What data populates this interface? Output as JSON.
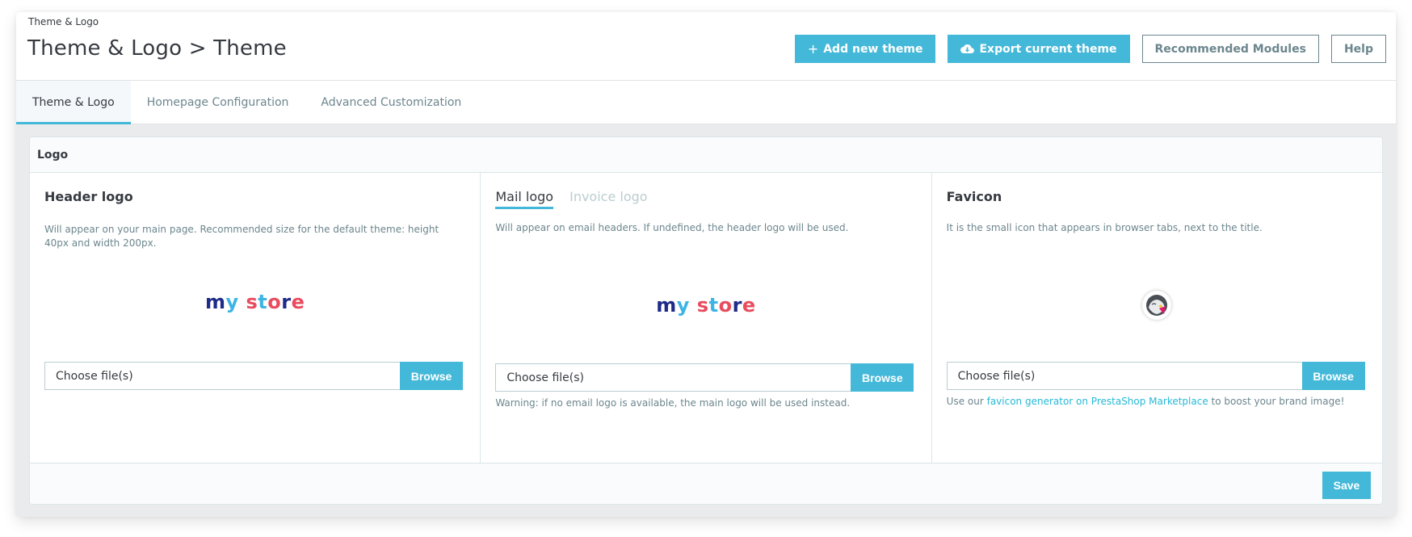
{
  "header": {
    "breadcrumb": "Theme & Logo",
    "title": "Theme & Logo > Theme",
    "toolbar": {
      "add_theme": "Add new theme",
      "export_theme": "Export current theme",
      "recommended_modules": "Recommended Modules",
      "help": "Help"
    }
  },
  "tabs": [
    {
      "label": "Theme & Logo",
      "active": true
    },
    {
      "label": "Homepage Configuration",
      "active": false
    },
    {
      "label": "Advanced Customization",
      "active": false
    }
  ],
  "card": {
    "title": "Logo",
    "header_logo": {
      "title": "Header logo",
      "description": "Will appear on your main page. Recommended size for the default theme: height 40px and width 200px.",
      "preview_text": "my store",
      "file_placeholder": "Choose file(s)",
      "browse": "Browse"
    },
    "mail_logo": {
      "subtabs": [
        "Mail logo",
        "Invoice logo"
      ],
      "active_subtab": "Mail logo",
      "description": "Will appear on email headers. If undefined, the header logo will be used.",
      "preview_text": "my store",
      "file_placeholder": "Choose file(s)",
      "browse": "Browse",
      "warning": "Warning: if no email logo is available, the main logo will be used instead."
    },
    "favicon": {
      "title": "Favicon",
      "description": "It is the small icon that appears in browser tabs, next to the title.",
      "file_placeholder": "Choose file(s)",
      "browse": "Browse",
      "help_prefix": "Use our ",
      "help_link": "favicon generator on PrestaShop Marketplace",
      "help_suffix": " to boost your brand image!"
    },
    "save": "Save"
  },
  "colors": {
    "primary": "#44b8d8",
    "text": "#363a41",
    "muted": "#6c868e",
    "link": "#25b9d7"
  }
}
